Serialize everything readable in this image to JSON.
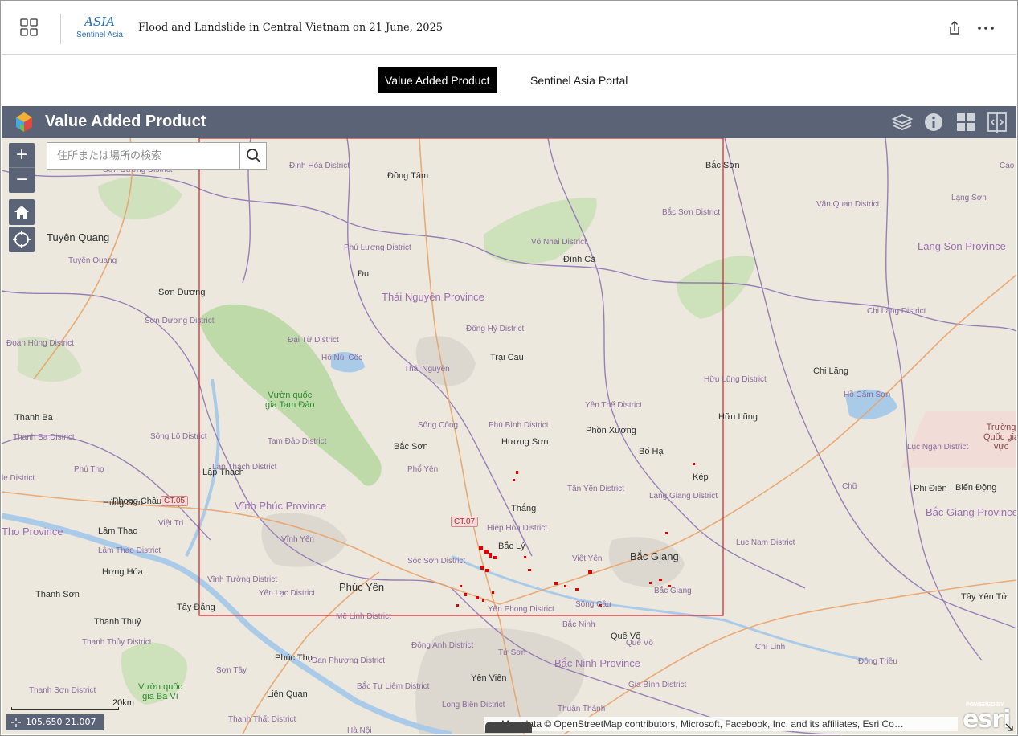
{
  "header": {
    "logo_mark": "ASIA",
    "logo_text": "Sentinel Asia",
    "title": "Flood and Landslide in Central Vietnam on 21 June, 2025",
    "icons": [
      "apps-grid-icon",
      "share-icon",
      "more-horizontal-icon"
    ]
  },
  "tabs": [
    {
      "label": "Value Added Product",
      "active": true
    },
    {
      "label": "Sentinel Asia Portal",
      "active": false
    }
  ],
  "map_bar": {
    "title": "Value Added Product",
    "tools": [
      "layers-icon",
      "info-icon",
      "basemap-gallery-icon",
      "swipe-compare-icon"
    ]
  },
  "map": {
    "search_placeholder": "住所または場所の検索",
    "zoom_in": "+",
    "zoom_out": "−",
    "scale_label": "20km",
    "coordinates": "105.650 21.007 度",
    "attribution": "Map data © OpenStreetMap contributors, Microsoft, Facebook, Inc. and its affiliates, Esri Co…",
    "esri_powered": "POWERED BY",
    "esri_word": "esri",
    "colors": {
      "aoi_outline": "#d0202a",
      "flood": "#e00000",
      "road": "#e8a36a",
      "boundary": "#8a6fb0",
      "forest": "#b9d8a3",
      "water": "#a9cbe8",
      "urban": "#d9d6cf"
    },
    "road_shields": [
      "CT.05",
      "CT.07"
    ],
    "labels": {
      "provinces": [
        "Thái Nguyên Province",
        "Vĩnh Phúc Province",
        "Lang Son Province",
        "Bắc Giang Province",
        "Bắc Ninh Province",
        "Tho Province"
      ],
      "cities": [
        "Đồng Tâm",
        "Bắc Sơn",
        "Tuyên Quang",
        "Đình Cả",
        "Đu",
        "Sơn Dương",
        "Trại Cau",
        "Chi Lăng",
        "Thanh Ba",
        "Hữu Lũng",
        "Bắc Sơn",
        "Hương Sơn",
        "Phồn Xương",
        "Bố Hạ",
        "Lập Thạch",
        "Phong Châu",
        "Kép",
        "Phi Điền",
        "Biển Động",
        "Hùng Sơn",
        "Thắng",
        "Lâm Thao",
        "Bắc Lý",
        "Hưng Hóa",
        "Phúc Yên",
        "Bắc Giang",
        "Thanh Sơn",
        "Tây Đằng",
        "Tây Yên Tử",
        "Thanh Thuỷ",
        "Quế Võ",
        "Phúc Thọ",
        "Liên Quan",
        "Yên Viên"
      ],
      "districts": [
        "Sơn Dương District",
        "Định Hóa District",
        "Bắc Sơn District",
        "Văn Quan District",
        "Lạng Sơn",
        "Tuyên Quang",
        "Võ Nhai District",
        "Phú Lương District",
        "Chi Lăng District",
        "Sơn Dương District",
        "Đoan Hùng District",
        "Đại Từ District",
        "Đồng Hỷ District",
        "Hồ Núi Cốc",
        "Thái Nguyên",
        "Hữu Lũng District",
        "Hồ Cấm Sơn",
        "Yên Thế District",
        "Sông Công",
        "Phú Bình District",
        "Thanh Ba District",
        "Sông Lô District",
        "Tam Đảo District",
        "Lục Ngạn District",
        "Lập Thạch District",
        "Phú Thọ",
        "Phổ Yên",
        "Tân Yên District",
        "Lạng Giang District",
        "Chũ",
        "Việt Trì",
        "Hiệp Hòa District",
        "Lâm Thao District",
        "Vĩnh Yên",
        "Việt Yên",
        "Lục Nam District",
        "Sóc Sơn District",
        "Vĩnh Tường District",
        "Yên Lạc District",
        "Sông Cầu",
        "Bắc Giang",
        "Yên Phong District",
        "Mê Linh District",
        "Bắc Ninh",
        "Thanh Thủy District",
        "Đông Anh District",
        "Quế Võ",
        "Chí Linh",
        "Sơn Tây",
        "Đan Phượng District",
        "Tứ Sơn",
        "Đông Triều",
        "Thanh Sơn District",
        "Bắc Tự Liêm District",
        "Gia Bình District",
        "Long Biên District",
        "Thuận Thành",
        "Thanh Thất District",
        "Hà Nội",
        "Cao",
        "le District"
      ],
      "parks": [
        "Vườn quốc\ngia Tam Đảo",
        "Vườn quốc\ngia Ba Vì",
        "Trường\nQuốc gia\nvực"
      ]
    }
  }
}
